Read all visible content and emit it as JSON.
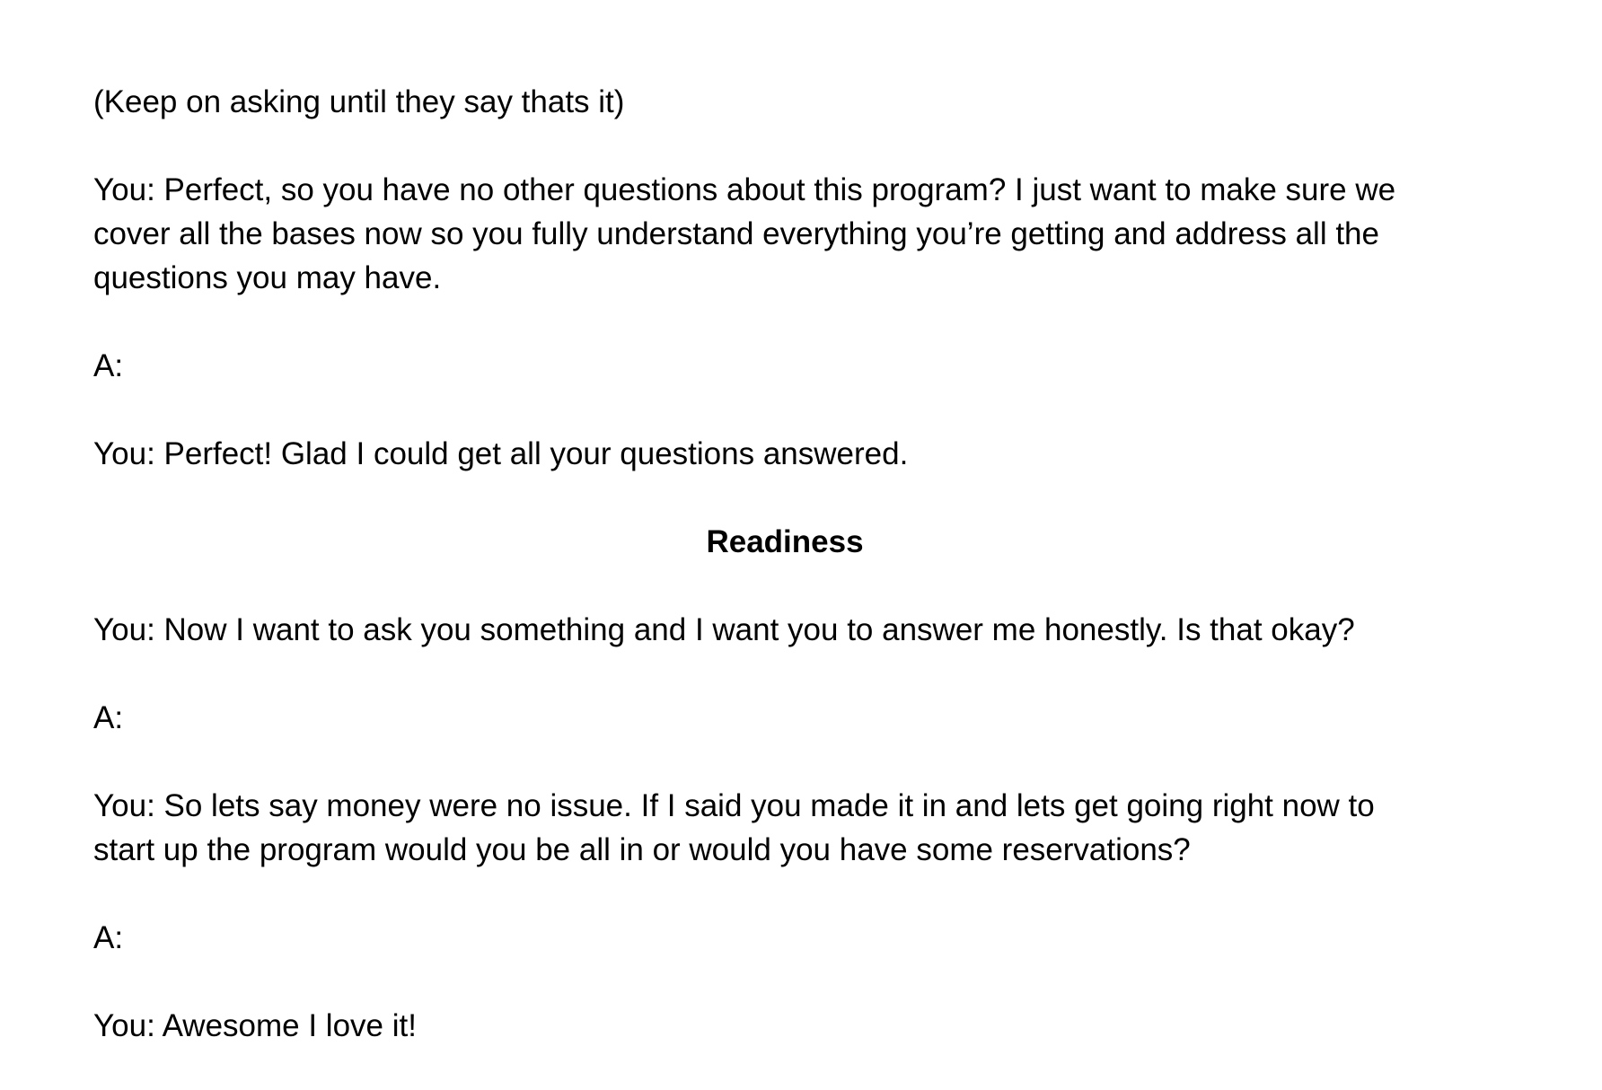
{
  "document": {
    "p1": "(Keep on asking until they say thats it)",
    "p2": {
      "line1": "You: Perfect, so you have no other questions about this program? I just want to make sure we",
      "line2": "cover all the bases now so you fully understand everything you’re getting and address all the",
      "line3": "questions you may have."
    },
    "p3": "A:",
    "p4": "You: Perfect! Glad I could get all your questions answered.",
    "heading": "Readiness",
    "p5": "You: Now I want to ask you something and I want you to answer me honestly. Is that okay?",
    "p6": "A:",
    "p7": {
      "line1": "You: So lets say money were no issue. If I said you made it in and lets get going right now to",
      "line2": "start up the program would you be all in or would you have some reservations?"
    },
    "p8": "A:",
    "p9": "You: Awesome I love it!"
  }
}
